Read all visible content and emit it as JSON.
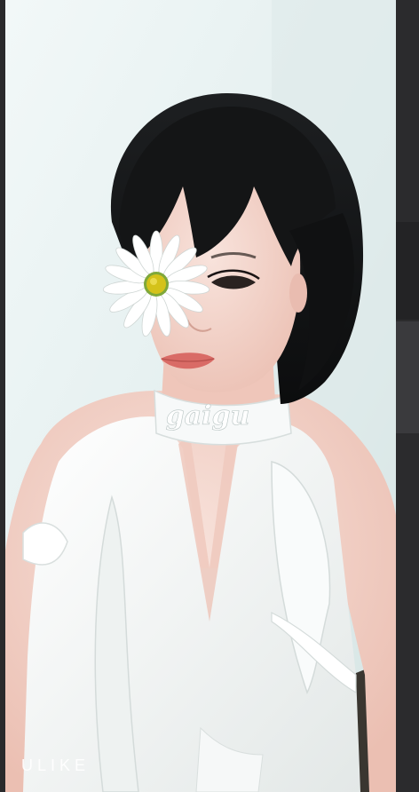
{
  "watermark": {
    "text": "gaigu"
  },
  "camera_brand": {
    "text": "ULIKE"
  },
  "colors": {
    "wall": "#e6f0f0",
    "hair": "#121314",
    "skin": "#f1cfc5",
    "blouse": "#f4f6f5",
    "lips": "#d96b66",
    "daisy_center": "#d4c21a"
  }
}
